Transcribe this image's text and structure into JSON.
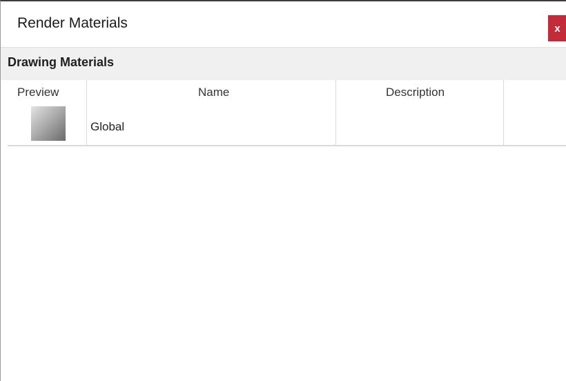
{
  "window": {
    "title": "Render Materials",
    "close_label": "x"
  },
  "section": {
    "title": "Drawing Materials"
  },
  "table": {
    "columns": [
      "Preview",
      "Name",
      "Description",
      ""
    ],
    "rows": [
      {
        "name": "Global",
        "description": ""
      }
    ]
  }
}
